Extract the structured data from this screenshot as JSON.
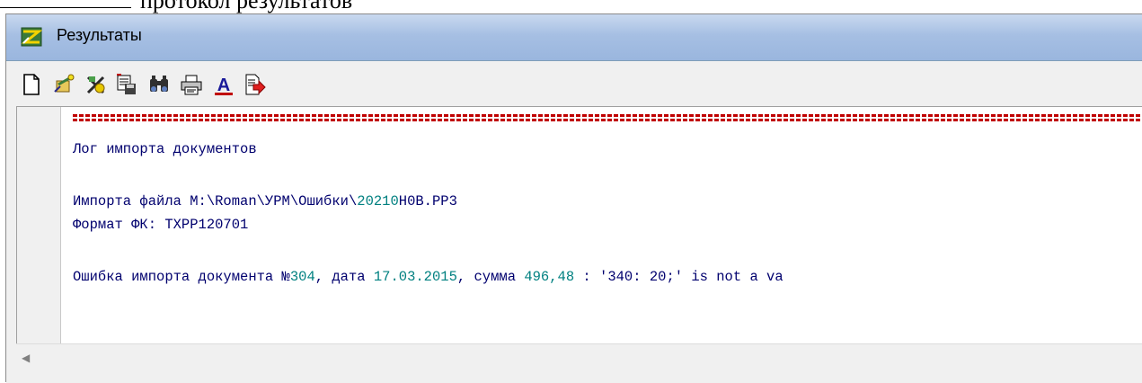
{
  "document": {
    "text_fragment": "протокол результатов"
  },
  "window": {
    "title": "Результаты"
  },
  "toolbar": {
    "buttons": [
      {
        "icon": "new-document-icon"
      },
      {
        "icon": "open-wand-icon"
      },
      {
        "icon": "clear-icon"
      },
      {
        "icon": "save-icon"
      },
      {
        "icon": "find-binoculars-icon"
      },
      {
        "icon": "print-icon"
      },
      {
        "icon": "font-icon",
        "glyph": "A"
      },
      {
        "icon": "export-icon"
      }
    ]
  },
  "log": {
    "title": "Лог импорта документов",
    "file_prefix": "Импорта файла M:\\Roman\\УРМ\\Ошибки\\",
    "file_number": "20210",
    "file_suffix": "H0B.PP3",
    "format_line": "Формат ФК: TXPP120701",
    "error_prefix": "Ошибка импорта документа №",
    "error_doc_number": "304",
    "error_date_label": ", дата ",
    "error_date": "17.03.2015",
    "error_sum_label": ", сумма ",
    "error_sum": "496,48",
    "error_rest": " : '340: 20;' is not a va"
  },
  "colors": {
    "title_gradient_top": "#c9d9ef",
    "title_gradient_bottom": "#9ab6de",
    "log_text": "#00006e",
    "log_highlight": "#008080",
    "separator": "#c00000"
  }
}
